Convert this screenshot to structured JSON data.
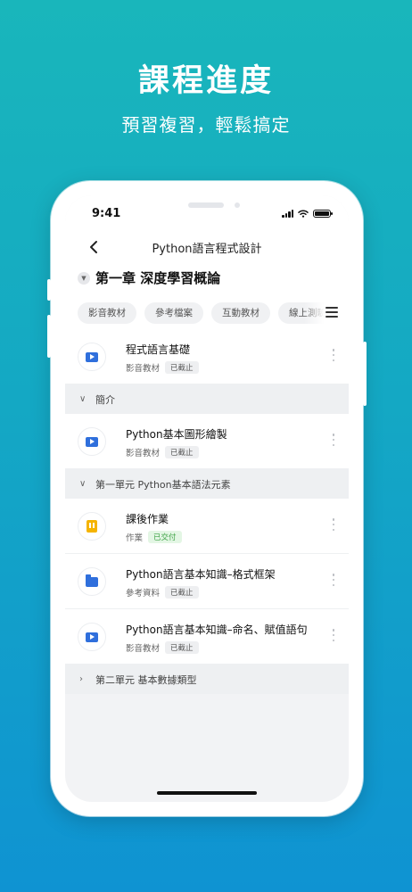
{
  "promo": {
    "title": "課程進度",
    "subtitle": "預習複習，輕鬆搞定"
  },
  "status_bar": {
    "time": "9:41",
    "icons": [
      "signal-icon",
      "wifi-icon",
      "battery-icon"
    ]
  },
  "nav": {
    "back_icon": "chevron-left-icon",
    "title": "Python語言程式設計"
  },
  "chapter": {
    "caret_icon": "caret-down-icon",
    "title": "第一章 深度學習概論"
  },
  "filters": [
    "影音教材",
    "參考檔案",
    "互動教材",
    "線上測驗"
  ],
  "filter_menu_icon": "menu-icon",
  "items_top": [
    {
      "title": "程式語言基礎",
      "type": "影音教材",
      "status": "已截止",
      "icon": "play-video-icon"
    }
  ],
  "sections": {
    "intro": {
      "label": "簡介",
      "caret": "chevron-down-icon"
    },
    "unit1": {
      "label": "第一單元 Python基本語法元素",
      "caret": "chevron-down-icon"
    },
    "unit2": {
      "label": "第二單元 基本數據類型",
      "caret": "chevron-right-icon"
    }
  },
  "items_intro": [
    {
      "title": "Python基本圖形繪製",
      "type": "影音教材",
      "status": "已截止",
      "icon": "play-video-icon"
    }
  ],
  "items_unit1": [
    {
      "title": "課後作業",
      "type": "作業",
      "status": "已交付",
      "icon": "homework-icon"
    },
    {
      "title": "Python語言基本知識–格式框架",
      "type": "參考資料",
      "status": "已截止",
      "icon": "folder-icon"
    },
    {
      "title": "Python語言基本知識–命名、賦值語句",
      "type": "影音教材",
      "status": "已截止",
      "icon": "play-video-icon"
    }
  ],
  "colors": {
    "background_top": "#19b6bb",
    "background_bottom": "#0f93d2",
    "accent_blue": "#2f6fdc",
    "homework_yellow": "#f5b400",
    "submitted_green": "#3fa346"
  }
}
